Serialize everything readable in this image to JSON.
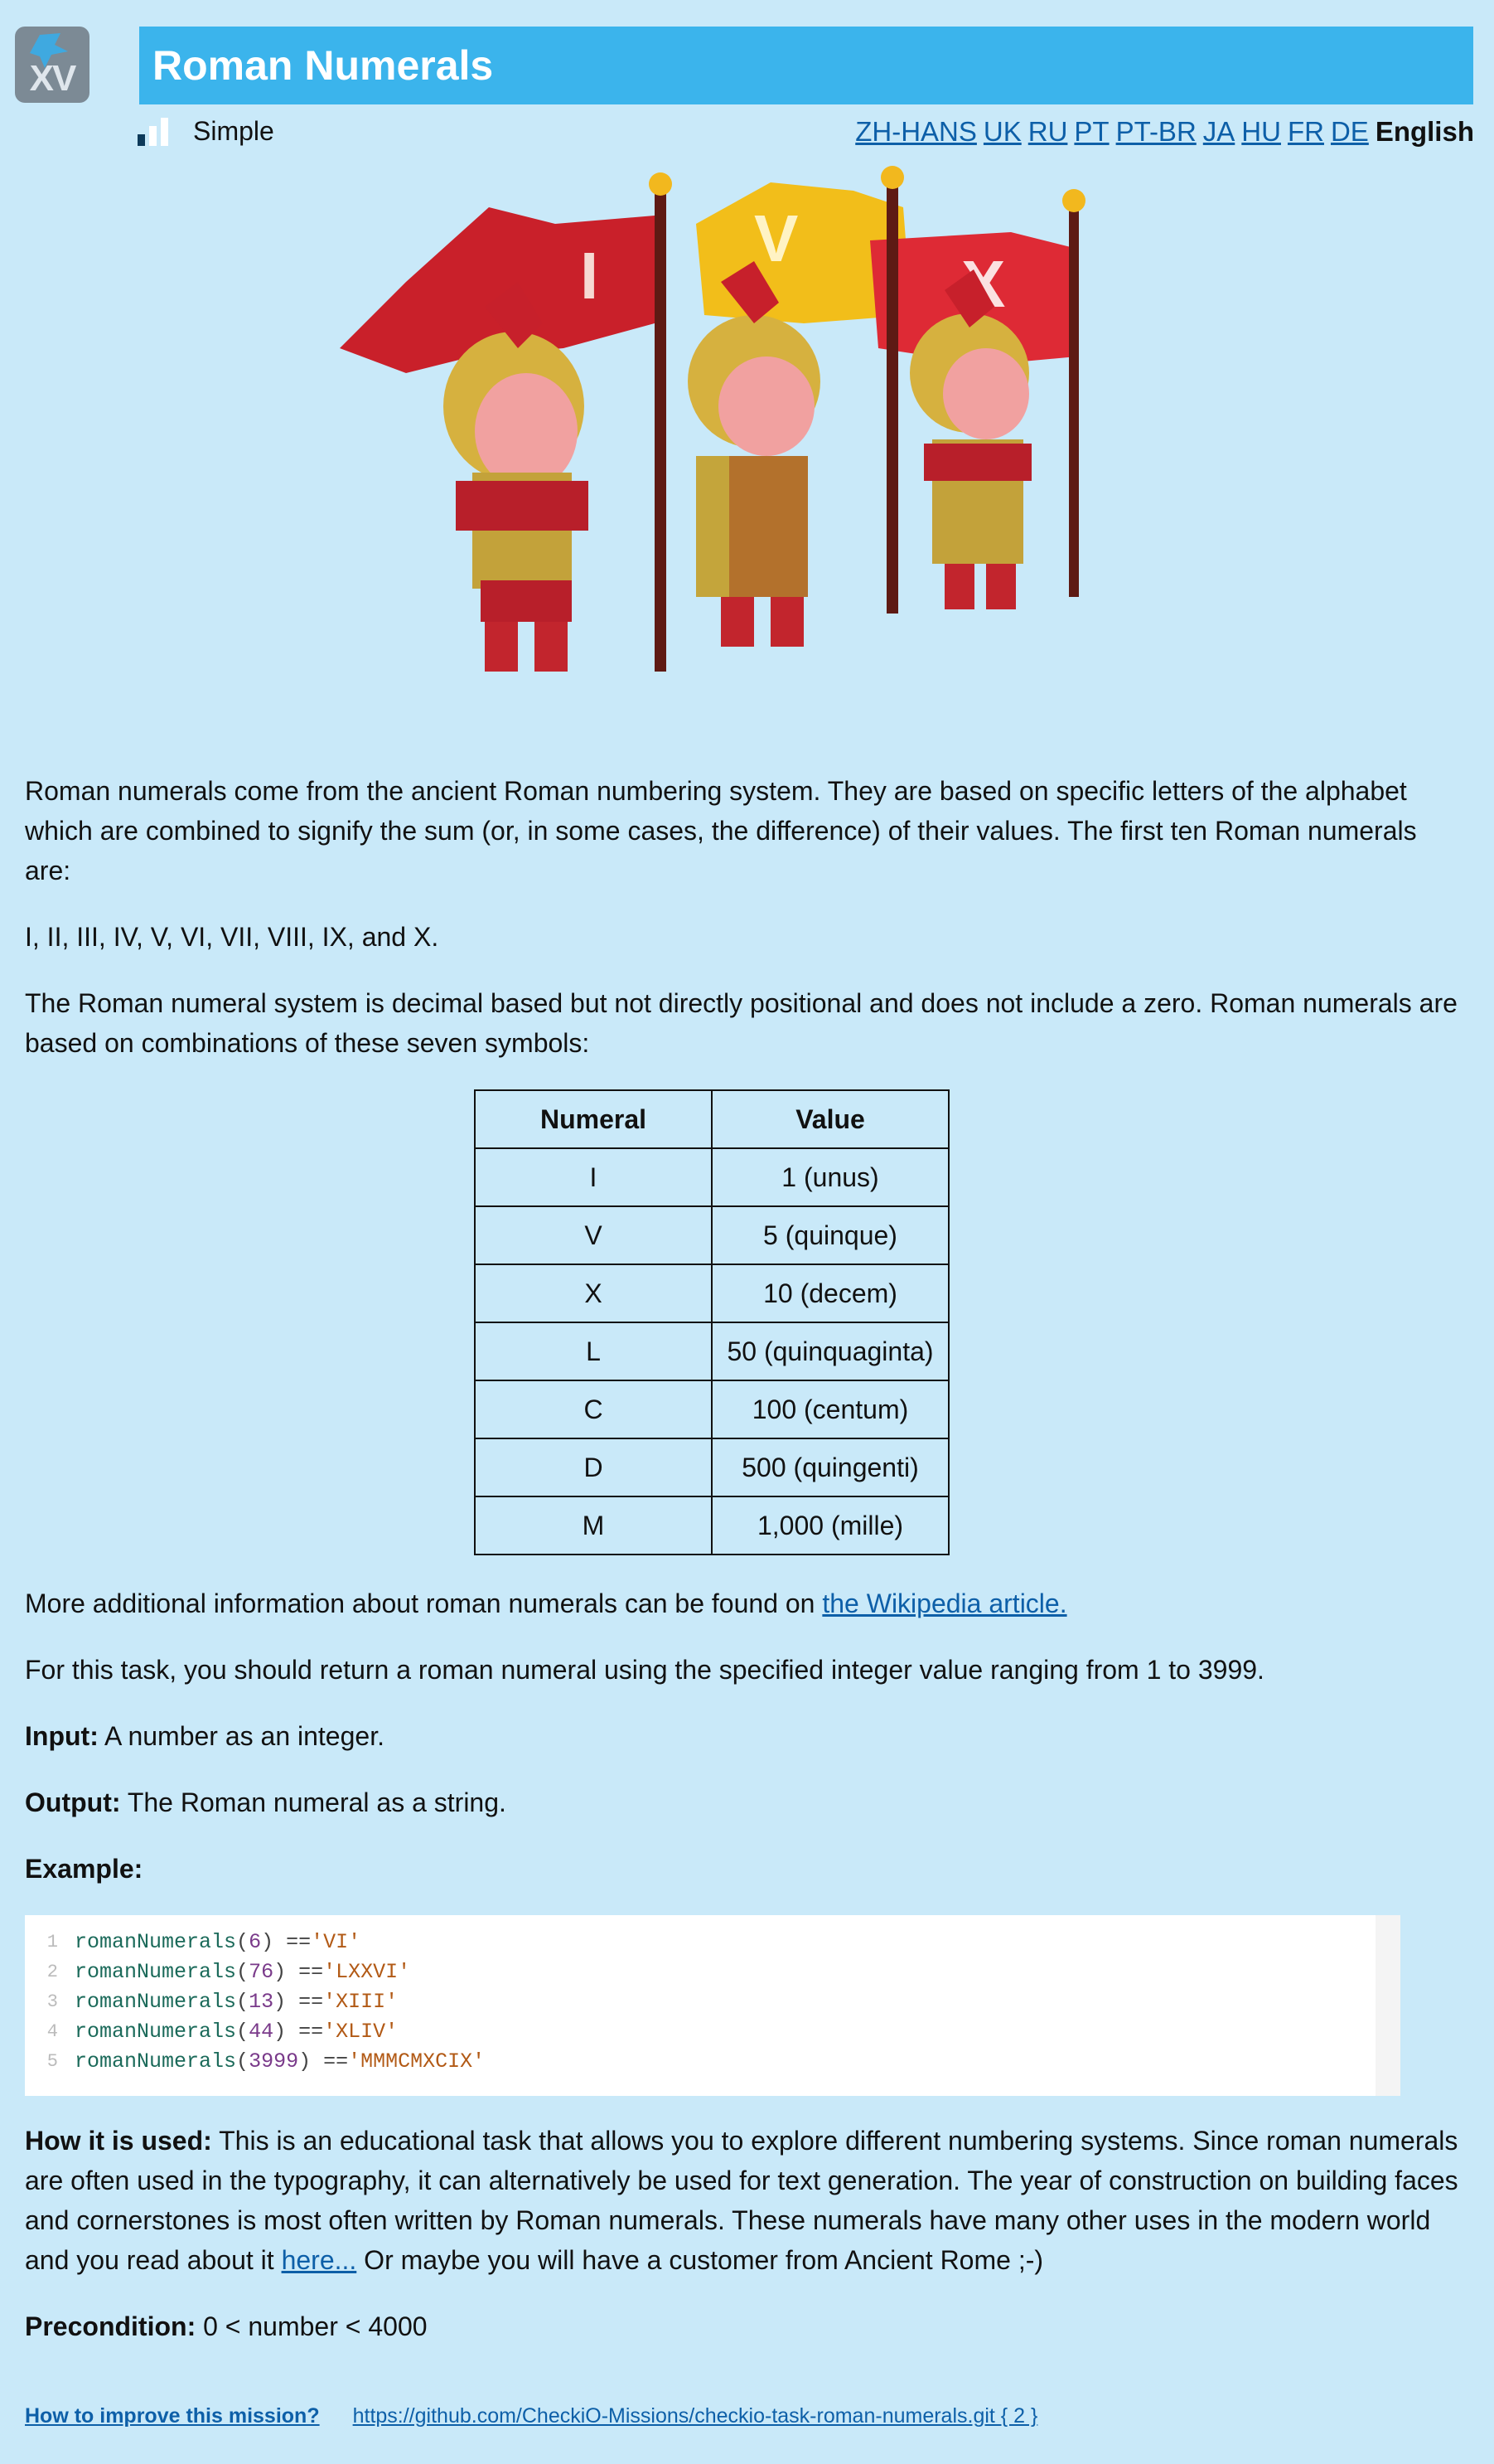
{
  "header": {
    "logo_text": "XV",
    "title": "Roman Numerals",
    "difficulty": "Simple"
  },
  "languages": {
    "links": [
      "ZH-HANS",
      "UK",
      "RU",
      "PT",
      "PT-BR",
      "JA",
      "HU",
      "FR",
      "DE"
    ],
    "current": "English"
  },
  "illustration": {
    "flag_letters": [
      "I",
      "V",
      "X"
    ]
  },
  "content": {
    "intro": "Roman numerals come from the ancient Roman numbering system. They are based on specific letters of the alphabet which are combined to signify the sum (or, in some cases, the difference) of their values. The first ten Roman numerals are:",
    "first_ten": "I, II, III, IV, V, VI, VII, VIII, IX, and X.",
    "system": "The Roman numeral system is decimal based but not directly positional and does not include a zero. Roman numerals are based on combinations of these seven symbols:",
    "table": {
      "headers": [
        "Numeral",
        "Value"
      ],
      "rows": [
        [
          "I",
          "1 (unus)"
        ],
        [
          "V",
          "5 (quinque)"
        ],
        [
          "X",
          "10 (decem)"
        ],
        [
          "L",
          "50 (quinquaginta)"
        ],
        [
          "C",
          "100 (centum)"
        ],
        [
          "D",
          "500 (quingenti)"
        ],
        [
          "M",
          "1,000 (mille)"
        ]
      ]
    },
    "more_info_prefix": "More additional information about roman numerals can be found on ",
    "more_info_link": "the Wikipedia article.",
    "task": "For this task, you should return a roman numeral using the specified integer value ranging from 1 to 3999.",
    "input_label": "Input:",
    "input_text": " A number as an integer.",
    "output_label": "Output:",
    "output_text": " The Roman numeral as a string.",
    "example_label": "Example:",
    "code": [
      {
        "n": "1",
        "fn": "romanNumerals",
        "arg": "6",
        "result": "'VI'"
      },
      {
        "n": "2",
        "fn": "romanNumerals",
        "arg": "76",
        "result": "'LXXVI'"
      },
      {
        "n": "3",
        "fn": "romanNumerals",
        "arg": "13",
        "result": "'XIII'"
      },
      {
        "n": "4",
        "fn": "romanNumerals",
        "arg": "44",
        "result": "'XLIV'"
      },
      {
        "n": "5",
        "fn": "romanNumerals",
        "arg": "3999",
        "result": "'MMMCMXCIX'"
      }
    ],
    "how_label": "How it is used:",
    "how_text": " This is an educational task that allows you to explore different numbering systems. Since roman numerals are often used in the typography, it can alternatively be used for text generation. The year of construction on building faces and cornerstones is most often written by Roman numerals. These numerals have many other uses in the modern world and you read about it ",
    "how_link": "here...",
    "how_suffix": " Or maybe you will have a customer from Ancient Rome ;-)",
    "precondition_label": "Precondition:",
    "precondition_text": " 0 < number < 4000"
  },
  "footer": {
    "improve_link": "How to improve this mission?",
    "repo_link": "https://github.com/CheckiO-Missions/checkio-task-roman-numerals.git { 2 }"
  },
  "colors": {
    "page_bg": "#c9e9f9",
    "title_bar": "#3bb4ec",
    "link": "#0d5fa8"
  }
}
